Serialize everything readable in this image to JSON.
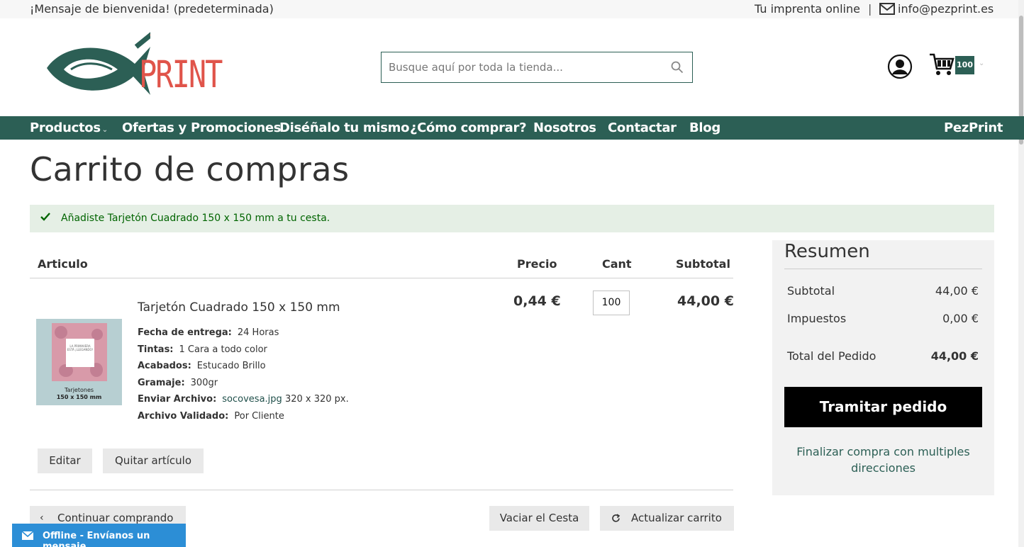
{
  "topbar": {
    "welcome": "¡Mensaje de bienvenida! (predeterminada)",
    "tagline": "Tu imprenta online",
    "separator": "|",
    "email": "info@pezprint.es"
  },
  "logo": {
    "text": "PRINT"
  },
  "search": {
    "placeholder": "Busque aquí por toda la tienda..."
  },
  "cart": {
    "count": "100"
  },
  "nav": {
    "items": [
      "Productos",
      "Ofertas y Promociones",
      "Diséñalo tu mismo",
      "¿Cómo comprar?",
      "Nosotros",
      "Contactar",
      "Blog"
    ],
    "brand": "PezPrint"
  },
  "page": {
    "title": "Carrito de compras"
  },
  "alert": {
    "message": "Añadiste Tarjetón Cuadrado 150 x 150 mm a tu cesta."
  },
  "table": {
    "headers": {
      "item": "Articulo",
      "price": "Precio",
      "qty": "Cant",
      "subtotal": "Subtotal"
    }
  },
  "product": {
    "name": "Tarjetón Cuadrado 150 x 150 mm",
    "thumb_caption_1": "Tarjetones",
    "thumb_caption_2": "150 x 150 mm",
    "thumb_card_text": "LA PRIMAVERA ESTÁ ¡LLEGANDO!",
    "options": [
      {
        "label": "Fecha de entrega:",
        "value": "24 Horas"
      },
      {
        "label": "Tintas:",
        "value": "1 Cara a todo color"
      },
      {
        "label": "Acabados:",
        "value": "Estucado Brillo"
      },
      {
        "label": "Gramaje:",
        "value": "300gr"
      },
      {
        "label": "Enviar Archivo:",
        "value": "socovesa.jpg",
        "extra": "320 x 320 px."
      },
      {
        "label": "Archivo Validado:",
        "value": "Por Cliente"
      }
    ],
    "price": "0,44 €",
    "qty": "100",
    "subtotal": "44,00 €",
    "edit_label": "Editar",
    "remove_label": "Quitar artículo"
  },
  "actions": {
    "continue": "Continuar comprando",
    "empty": "Vaciar el Cesta",
    "update": "Actualizar carrito"
  },
  "summary": {
    "title": "Resumen",
    "subtotal_label": "Subtotal",
    "subtotal_value": "44,00 €",
    "tax_label": "Impuestos",
    "tax_value": "0,00 €",
    "total_label": "Total del Pedido",
    "total_value": "44,00 €",
    "checkout": "Tramitar pedido",
    "multi": "Finalizar compra con multiples direcciones"
  },
  "chat": {
    "label": "Offline - Envíanos un mensaje"
  },
  "colors": {
    "brand": "#2c5f55",
    "accent": "#e0544a",
    "success_bg": "#e5efe5",
    "chat": "#2c8ed6"
  }
}
